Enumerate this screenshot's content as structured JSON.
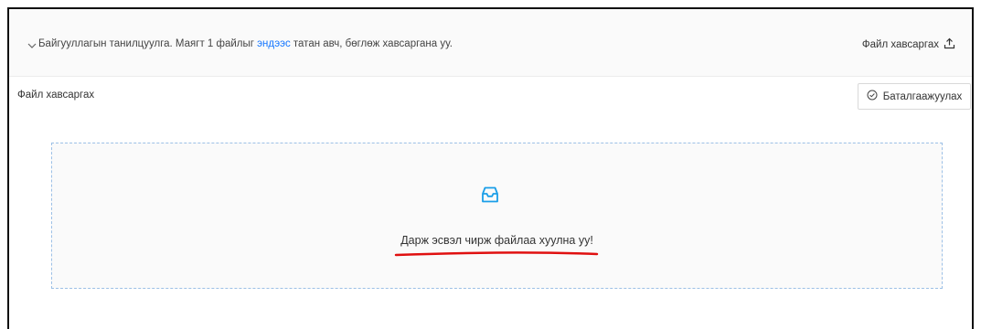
{
  "header": {
    "text_before_link": "Байгууллагын танилцуулга. Маягт 1 файлыг ",
    "link_text": "эндээс",
    "text_after_link": " татан авч, бөглөж хавсаргана уу.",
    "upload_label": "Файл хавсаргах",
    "toggle_icon": "chevron-down-icon",
    "upload_icon": "upload-icon"
  },
  "section": {
    "label": "Файл хавсаргах",
    "confirm_button": "Баталгаажуулах",
    "confirm_icon": "check-circle-icon"
  },
  "dropzone": {
    "text": "Дарж эсвэл чирж файлаа хуулна уу!",
    "icon": "inbox-icon"
  },
  "colors": {
    "link": "#1677ff",
    "dropzone_border": "#9cc0e6",
    "icon_accent": "#1a9ee8",
    "annotation_underline": "#e01010"
  }
}
